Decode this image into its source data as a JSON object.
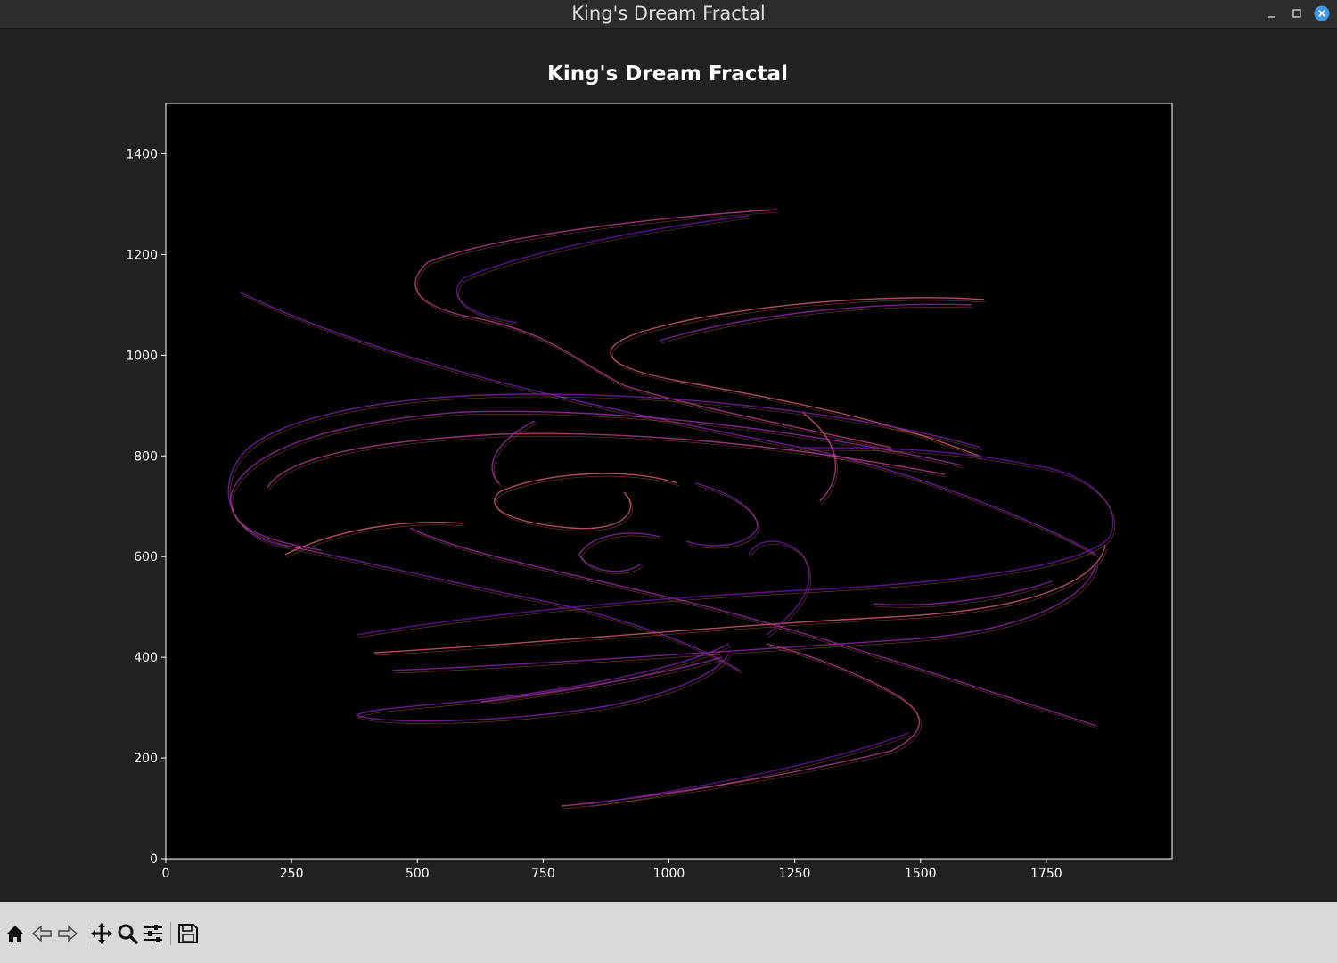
{
  "window": {
    "title": "King's Dream Fractal",
    "controls": {
      "minimize": "–",
      "maximize": "□",
      "close": "×"
    }
  },
  "colors": {
    "figure_bg": "#212121",
    "plot_bg": "#000000",
    "text": "#ffffff",
    "close_button": "#3d9be9",
    "toolbar_bg": "#d9d9d9",
    "colormap": "plasma"
  },
  "chart_data": {
    "type": "scatter",
    "title": "King's Dream Fractal",
    "xlabel": "",
    "ylabel": "",
    "xlim": [
      0,
      2000
    ],
    "ylim": [
      0,
      1500
    ],
    "xticks": [
      0,
      250,
      500,
      750,
      1000,
      1250,
      1500,
      1750
    ],
    "yticks": [
      0,
      200,
      400,
      600,
      800,
      1000,
      1200,
      1400
    ],
    "grid": false,
    "legend": "none",
    "colormap": "plasma",
    "description_points_approx": {
      "x_range": [
        150,
        1880
      ],
      "y_range": [
        155,
        1345
      ]
    }
  },
  "toolbar": {
    "buttons": [
      {
        "name": "home-button",
        "icon": "home-icon",
        "tooltip": "Home"
      },
      {
        "name": "back-button",
        "icon": "back-arrow-icon",
        "tooltip": "Back"
      },
      {
        "name": "forward-button",
        "icon": "forward-arrow-icon",
        "tooltip": "Forward"
      },
      {
        "name": "pan-button",
        "icon": "move-icon",
        "tooltip": "Pan"
      },
      {
        "name": "zoom-button",
        "icon": "magnifier-icon",
        "tooltip": "Zoom"
      },
      {
        "name": "configure-subplots-button",
        "icon": "sliders-icon",
        "tooltip": "Subplots"
      },
      {
        "name": "save-button",
        "icon": "floppy-disk-icon",
        "tooltip": "Save"
      }
    ]
  }
}
